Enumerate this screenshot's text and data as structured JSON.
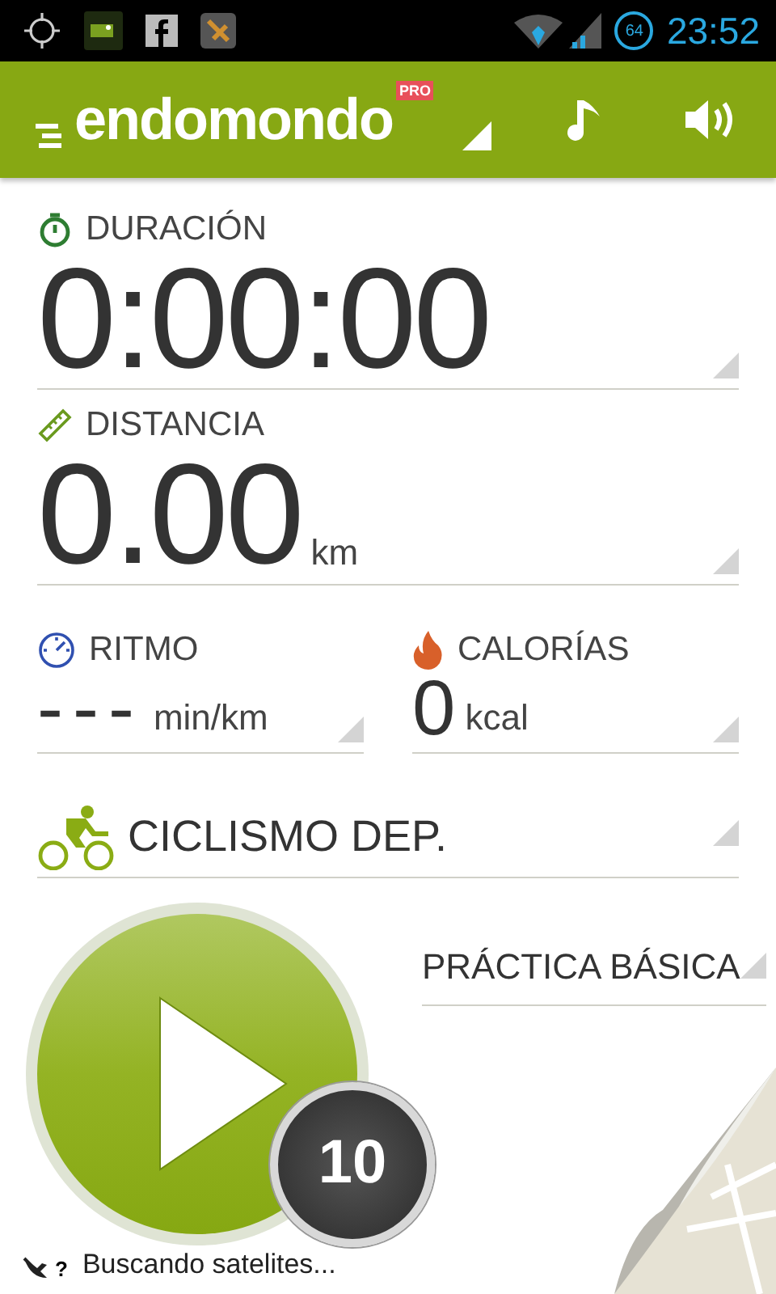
{
  "status_bar": {
    "battery": "64",
    "time": "23:52"
  },
  "header": {
    "logo": "endomondo",
    "badge": "PRO"
  },
  "fields": [
    {
      "kind": "duration",
      "label": "DURACIÓN",
      "value": "0:00:00"
    },
    {
      "kind": "distance",
      "label": "DISTANCIA",
      "value": "0.00",
      "unit": "km"
    }
  ],
  "metrics": [
    {
      "kind": "pace",
      "label": "RITMO",
      "value": "---",
      "unit": "min/km"
    },
    {
      "kind": "calories",
      "label": "CALORÍAS",
      "value": "0",
      "unit": "kcal"
    }
  ],
  "sport": {
    "label": "CICLISMO DEP."
  },
  "workout": {
    "label": "PRÁCTICA BÁSICA"
  },
  "countdown": "10",
  "gps": {
    "mark": "?",
    "message": "Buscando satelites..."
  }
}
